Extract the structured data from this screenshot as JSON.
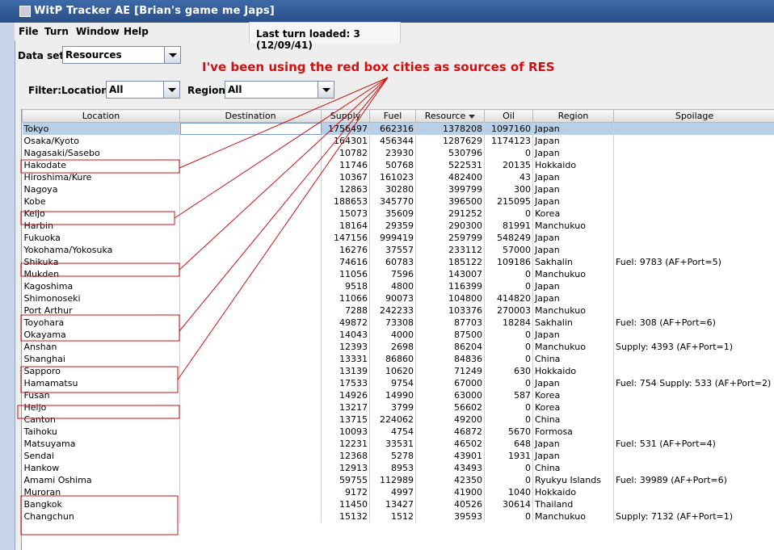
{
  "window": {
    "title": "WitP Tracker AE [Brian's game me Japs]"
  },
  "menu": [
    {
      "label": "File"
    },
    {
      "label": "Turn"
    },
    {
      "label": "Window"
    },
    {
      "label": "Help"
    }
  ],
  "status": {
    "last_turn": "Last turn loaded: 3 (12/09/41)"
  },
  "dataset": {
    "label": "Data set:",
    "value": "Resources"
  },
  "filter": {
    "label": "Filter:",
    "location_label": "Location:",
    "location_value": "All",
    "region_label": "Region:",
    "region_value": "All"
  },
  "annotation": {
    "text": "I've been using the red box cities as sources of RES",
    "color": "#d01010"
  },
  "table": {
    "columns": [
      "Location",
      "Destination",
      "Supply",
      "Fuel",
      "Resource",
      "Oil",
      "Region",
      "Spoilage"
    ],
    "sorted_column": "Resource",
    "rows": [
      {
        "location": "Tokyo",
        "destination": "",
        "supply": "1756497",
        "fuel": "662316",
        "resource": "1378208",
        "oil": "1097160",
        "region": "Japan",
        "spoilage": ""
      },
      {
        "location": "Osaka/Kyoto",
        "destination": "",
        "supply": "164301",
        "fuel": "456344",
        "resource": "1287629",
        "oil": "1174123",
        "region": "Japan",
        "spoilage": ""
      },
      {
        "location": "Nagasaki/Sasebo",
        "destination": "",
        "supply": "10782",
        "fuel": "23930",
        "resource": "530796",
        "oil": "0",
        "region": "Japan",
        "spoilage": ""
      },
      {
        "location": "Hakodate",
        "destination": "",
        "supply": "11746",
        "fuel": "50768",
        "resource": "522531",
        "oil": "20135",
        "region": "Hokkaido",
        "spoilage": ""
      },
      {
        "location": "Hiroshima/Kure",
        "destination": "",
        "supply": "10367",
        "fuel": "161023",
        "resource": "482400",
        "oil": "43",
        "region": "Japan",
        "spoilage": ""
      },
      {
        "location": "Nagoya",
        "destination": "",
        "supply": "12863",
        "fuel": "30280",
        "resource": "399799",
        "oil": "300",
        "region": "Japan",
        "spoilage": ""
      },
      {
        "location": "Kobe",
        "destination": "",
        "supply": "188653",
        "fuel": "345770",
        "resource": "396500",
        "oil": "215095",
        "region": "Japan",
        "spoilage": ""
      },
      {
        "location": "Keijo",
        "destination": "",
        "supply": "15073",
        "fuel": "35609",
        "resource": "291252",
        "oil": "0",
        "region": "Korea",
        "spoilage": ""
      },
      {
        "location": "Harbin",
        "destination": "",
        "supply": "18164",
        "fuel": "29359",
        "resource": "290300",
        "oil": "81991",
        "region": "Manchukuo",
        "spoilage": ""
      },
      {
        "location": "Fukuoka",
        "destination": "",
        "supply": "147156",
        "fuel": "999419",
        "resource": "259799",
        "oil": "548249",
        "region": "Japan",
        "spoilage": ""
      },
      {
        "location": "Yokohama/Yokosuka",
        "destination": "",
        "supply": "16276",
        "fuel": "37557",
        "resource": "233112",
        "oil": "57000",
        "region": "Japan",
        "spoilage": ""
      },
      {
        "location": "Shikuka",
        "destination": "",
        "supply": "74616",
        "fuel": "60783",
        "resource": "185122",
        "oil": "109186",
        "region": "Sakhalin",
        "spoilage": "Fuel: 9783 (AF+Port=5)"
      },
      {
        "location": "Mukden",
        "destination": "",
        "supply": "11056",
        "fuel": "7596",
        "resource": "143007",
        "oil": "0",
        "region": "Manchukuo",
        "spoilage": ""
      },
      {
        "location": "Kagoshima",
        "destination": "",
        "supply": "9518",
        "fuel": "4800",
        "resource": "116399",
        "oil": "0",
        "region": "Japan",
        "spoilage": ""
      },
      {
        "location": "Shimonoseki",
        "destination": "",
        "supply": "11066",
        "fuel": "90073",
        "resource": "104800",
        "oil": "414820",
        "region": "Japan",
        "spoilage": ""
      },
      {
        "location": "Port Arthur",
        "destination": "",
        "supply": "7288",
        "fuel": "242233",
        "resource": "103376",
        "oil": "270003",
        "region": "Manchukuo",
        "spoilage": ""
      },
      {
        "location": "Toyohara",
        "destination": "",
        "supply": "49872",
        "fuel": "73308",
        "resource": "87703",
        "oil": "18284",
        "region": "Sakhalin",
        "spoilage": "Fuel: 308 (AF+Port=6)"
      },
      {
        "location": "Okayama",
        "destination": "",
        "supply": "14043",
        "fuel": "4000",
        "resource": "87500",
        "oil": "0",
        "region": "Japan",
        "spoilage": ""
      },
      {
        "location": "Anshan",
        "destination": "",
        "supply": "12393",
        "fuel": "2698",
        "resource": "86204",
        "oil": "0",
        "region": "Manchukuo",
        "spoilage": "Supply: 4393 (AF+Port=1)"
      },
      {
        "location": "Shanghai",
        "destination": "",
        "supply": "13331",
        "fuel": "86860",
        "resource": "84836",
        "oil": "0",
        "region": "China",
        "spoilage": ""
      },
      {
        "location": "Sapporo",
        "destination": "",
        "supply": "13139",
        "fuel": "10620",
        "resource": "71249",
        "oil": "630",
        "region": "Hokkaido",
        "spoilage": ""
      },
      {
        "location": "Hamamatsu",
        "destination": "",
        "supply": "17533",
        "fuel": "9754",
        "resource": "67000",
        "oil": "0",
        "region": "Japan",
        "spoilage": "Fuel: 754 Supply: 533 (AF+Port=2)"
      },
      {
        "location": "Fusan",
        "destination": "",
        "supply": "14926",
        "fuel": "14990",
        "resource": "63000",
        "oil": "587",
        "region": "Korea",
        "spoilage": ""
      },
      {
        "location": "Heijo",
        "destination": "",
        "supply": "13217",
        "fuel": "3799",
        "resource": "56602",
        "oil": "0",
        "region": "Korea",
        "spoilage": ""
      },
      {
        "location": "Canton",
        "destination": "",
        "supply": "13715",
        "fuel": "224062",
        "resource": "49200",
        "oil": "0",
        "region": "China",
        "spoilage": ""
      },
      {
        "location": "Taihoku",
        "destination": "",
        "supply": "10093",
        "fuel": "4754",
        "resource": "46872",
        "oil": "5670",
        "region": "Formosa",
        "spoilage": ""
      },
      {
        "location": "Matsuyama",
        "destination": "",
        "supply": "12231",
        "fuel": "33531",
        "resource": "46502",
        "oil": "648",
        "region": "Japan",
        "spoilage": "Fuel: 531 (AF+Port=4)"
      },
      {
        "location": "Sendai",
        "destination": "",
        "supply": "12368",
        "fuel": "5278",
        "resource": "43901",
        "oil": "1931",
        "region": "Japan",
        "spoilage": ""
      },
      {
        "location": "Hankow",
        "destination": "",
        "supply": "12913",
        "fuel": "8953",
        "resource": "43493",
        "oil": "0",
        "region": "China",
        "spoilage": ""
      },
      {
        "location": "Amami Oshima",
        "destination": "",
        "supply": "59755",
        "fuel": "112989",
        "resource": "42350",
        "oil": "0",
        "region": "Ryukyu Islands",
        "spoilage": "Fuel: 39989 (AF+Port=6)"
      },
      {
        "location": "Muroran",
        "destination": "",
        "supply": "9172",
        "fuel": "4997",
        "resource": "41900",
        "oil": "1040",
        "region": "Hokkaido",
        "spoilage": ""
      },
      {
        "location": "Bangkok",
        "destination": "",
        "supply": "11450",
        "fuel": "13427",
        "resource": "40526",
        "oil": "30614",
        "region": "Thailand",
        "spoilage": ""
      },
      {
        "location": "Changchun",
        "destination": "",
        "supply": "15132",
        "fuel": "1512",
        "resource": "39593",
        "oil": "0",
        "region": "Manchukuo",
        "spoilage": "Supply: 7132 (AF+Port=1)"
      }
    ]
  }
}
